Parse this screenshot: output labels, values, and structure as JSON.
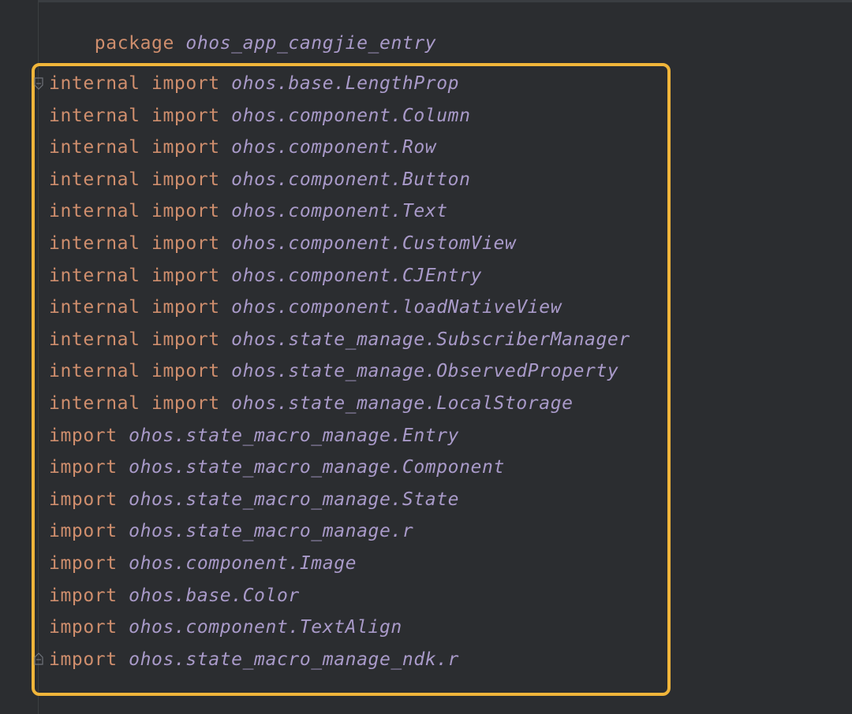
{
  "editor": {
    "package_line": {
      "keyword": "package",
      "name": "ohos_app_cangjie_entry"
    },
    "imports": [
      {
        "modifier": "internal",
        "keyword": "import",
        "path": "ohos.base.LengthProp"
      },
      {
        "modifier": "internal",
        "keyword": "import",
        "path": "ohos.component.Column"
      },
      {
        "modifier": "internal",
        "keyword": "import",
        "path": "ohos.component.Row"
      },
      {
        "modifier": "internal",
        "keyword": "import",
        "path": "ohos.component.Button"
      },
      {
        "modifier": "internal",
        "keyword": "import",
        "path": "ohos.component.Text"
      },
      {
        "modifier": "internal",
        "keyword": "import",
        "path": "ohos.component.CustomView"
      },
      {
        "modifier": "internal",
        "keyword": "import",
        "path": "ohos.component.CJEntry"
      },
      {
        "modifier": "internal",
        "keyword": "import",
        "path": "ohos.component.loadNativeView"
      },
      {
        "modifier": "internal",
        "keyword": "import",
        "path": "ohos.state_manage.SubscriberManager"
      },
      {
        "modifier": "internal",
        "keyword": "import",
        "path": "ohos.state_manage.ObservedProperty"
      },
      {
        "modifier": "internal",
        "keyword": "import",
        "path": "ohos.state_manage.LocalStorage"
      },
      {
        "modifier": "",
        "keyword": "import",
        "path": "ohos.state_macro_manage.Entry"
      },
      {
        "modifier": "",
        "keyword": "import",
        "path": "ohos.state_macro_manage.Component"
      },
      {
        "modifier": "",
        "keyword": "import",
        "path": "ohos.state_macro_manage.State"
      },
      {
        "modifier": "",
        "keyword": "import",
        "path": "ohos.state_macro_manage.r"
      },
      {
        "modifier": "",
        "keyword": "import",
        "path": "ohos.component.Image"
      },
      {
        "modifier": "",
        "keyword": "import",
        "path": "ohos.base.Color"
      },
      {
        "modifier": "",
        "keyword": "import",
        "path": "ohos.component.TextAlign"
      },
      {
        "modifier": "",
        "keyword": "import",
        "path": "ohos.state_macro_manage_ndk.r"
      }
    ]
  },
  "colors": {
    "background": "#2b2d30",
    "keyword": "#cf8e6d",
    "namespace": "#a99ac9",
    "highlight_border": "#f0b53a"
  },
  "icons": {
    "fold_start": "fold-start-icon",
    "fold_end": "fold-end-icon"
  }
}
